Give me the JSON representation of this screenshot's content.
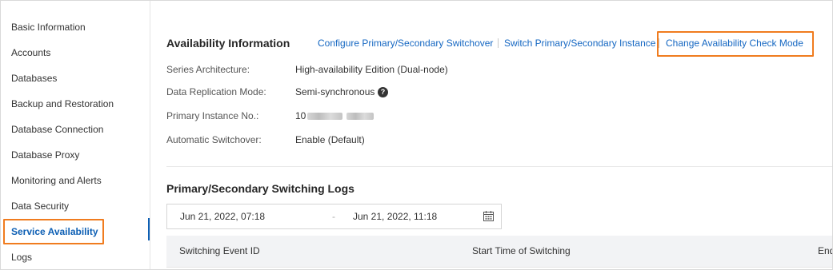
{
  "sidebar": {
    "items": [
      {
        "label": "Basic Information"
      },
      {
        "label": "Accounts"
      },
      {
        "label": "Databases"
      },
      {
        "label": "Backup and Restoration"
      },
      {
        "label": "Database Connection"
      },
      {
        "label": "Database Proxy"
      },
      {
        "label": "Monitoring and Alerts"
      },
      {
        "label": "Data Security"
      },
      {
        "label": "Service Availability"
      },
      {
        "label": "Logs"
      }
    ],
    "active_index": 8
  },
  "availability": {
    "title": "Availability Information",
    "actions": [
      {
        "label": "Configure Primary/Secondary Switchover"
      },
      {
        "label": "Switch Primary/Secondary Instance"
      },
      {
        "label": "Change Availability Check Mode"
      }
    ],
    "fields": [
      {
        "label": "Series Architecture:",
        "value": "High-availability Edition (Dual-node)"
      },
      {
        "label": "Data Replication Mode:",
        "value": "Semi-synchronous"
      },
      {
        "label": "Primary Instance No.:",
        "value": "10"
      },
      {
        "label": "Automatic Switchover:",
        "value": "Enable (Default)"
      }
    ],
    "help_icon": "question-circle-icon"
  },
  "logs": {
    "title": "Primary/Secondary Switching Logs",
    "date_range": {
      "start": "Jun 21, 2022, 07:18",
      "separator": "-",
      "end": "Jun 21, 2022, 11:18",
      "icon": "calendar-icon"
    },
    "columns": [
      {
        "label": "Switching Event ID"
      },
      {
        "label": "Start Time of Switching"
      },
      {
        "label": "End"
      }
    ]
  },
  "colors": {
    "link": "#1567c2",
    "active": "#0d5fb4",
    "highlight": "#f07c1f"
  }
}
